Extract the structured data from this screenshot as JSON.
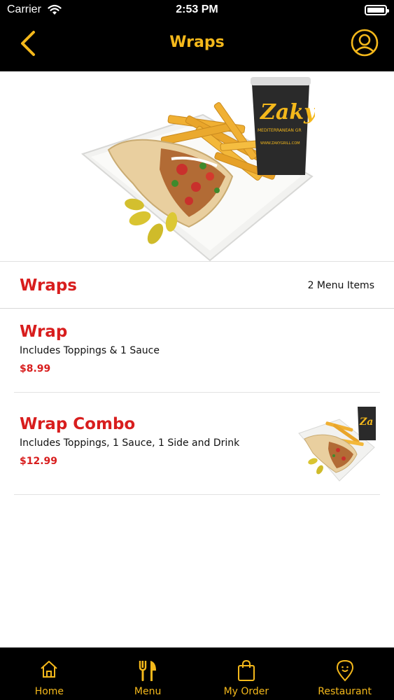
{
  "status_bar": {
    "carrier": "Carrier",
    "time": "2:53 PM"
  },
  "nav": {
    "title": "Wraps",
    "back_icon": "chevron-left-icon",
    "profile_icon": "user-circle-icon"
  },
  "hero": {
    "cup_brand": "Zaky",
    "cup_tagline": "MEDITERRANEAN GR",
    "cup_url": "WWW.ZAKYGRILL.COM"
  },
  "section": {
    "title": "Wraps",
    "count": "2 Menu Items"
  },
  "items": [
    {
      "name": "Wrap",
      "description": "Includes Toppings & 1 Sauce",
      "price": "$8.99"
    },
    {
      "name": "Wrap Combo",
      "description": "Includes Toppings, 1 Sauce, 1 Side and Drink",
      "price": "$12.99",
      "thumb_brand": "Za"
    }
  ],
  "tabs": [
    {
      "label": "Home",
      "icon": "home-icon"
    },
    {
      "label": "Menu",
      "icon": "fork-knife-icon"
    },
    {
      "label": "My Order",
      "icon": "shopping-bag-icon"
    },
    {
      "label": "Restaurant",
      "icon": "location-pin-icon"
    }
  ],
  "colors": {
    "accent": "#f4b81b",
    "red": "#d81e1e",
    "bar": "#000000"
  }
}
